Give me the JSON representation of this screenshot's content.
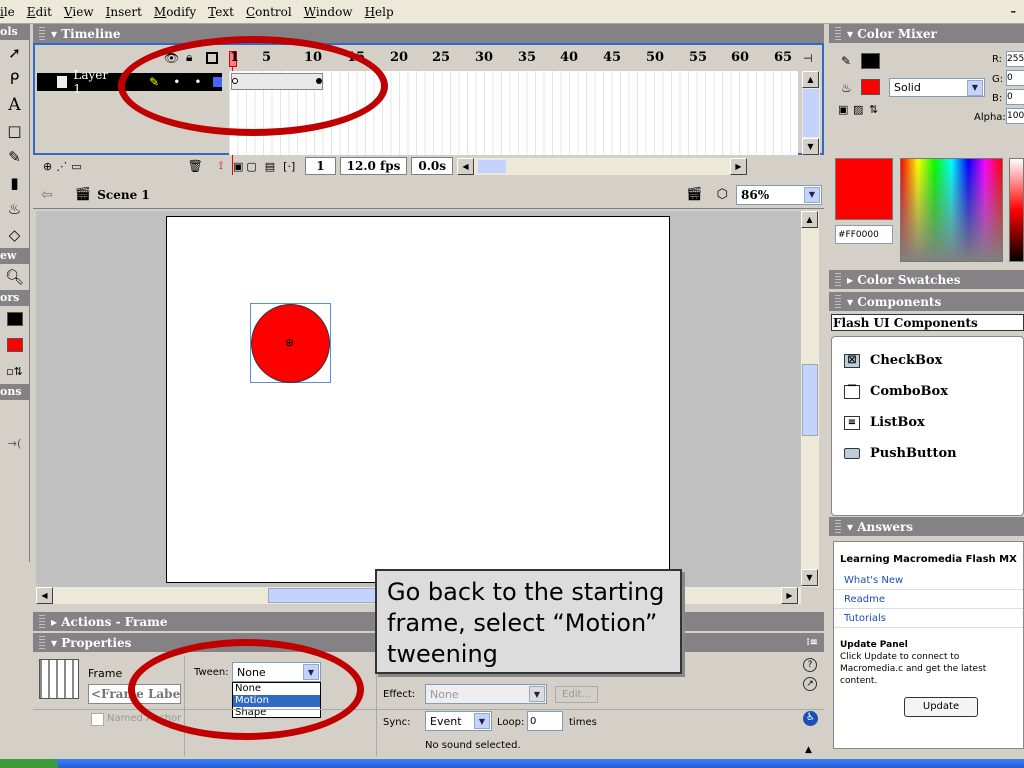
{
  "menu": {
    "items": [
      "ile",
      "Edit",
      "View",
      "Insert",
      "Modify",
      "Text",
      "Control",
      "Window",
      "Help"
    ]
  },
  "tools": {
    "sections": [
      "ols",
      "ew",
      "ors",
      "ons"
    ]
  },
  "timeline": {
    "title": "Timeline",
    "frame_numbers": [
      "1",
      "5",
      "10",
      "15",
      "20",
      "25",
      "30",
      "35",
      "40",
      "45",
      "50",
      "55",
      "60",
      "65"
    ],
    "layer_name": "Layer 1",
    "current_frame": "1",
    "fps": "12.0 fps",
    "elapsed": "0.0s"
  },
  "scene": {
    "name": "Scene 1",
    "zoom": "86%"
  },
  "stage": {
    "shape_color": "#ff0000"
  },
  "actions": {
    "title": "Actions - Frame"
  },
  "properties": {
    "title": "Properties",
    "frame_label": "Frame",
    "frame_input_placeholder": "<Frame Label>",
    "tween_label": "Tween:",
    "tween_value": "None",
    "tween_options": [
      "None",
      "Motion",
      "Shape"
    ],
    "named_anchor": "Named Anchor",
    "effect_label": "Effect:",
    "effect_value": "None",
    "edit_button": "Edit...",
    "sync_label": "Sync:",
    "sync_value": "Event",
    "loop_label": "Loop:",
    "loop_value": "0",
    "times_label": "times",
    "sound_status": "No sound selected."
  },
  "color_mixer": {
    "title": "Color Mixer",
    "fill_type": "Solid",
    "r_label": "R:",
    "r_value": "255",
    "g_label": "G:",
    "g_value": "0",
    "b_label": "B:",
    "b_value": "0",
    "alpha_label": "Alpha:",
    "alpha_value": "100",
    "hex": "#FF0000",
    "fill_color": "#ff0000"
  },
  "color_swatches": {
    "title": "Color Swatches"
  },
  "components": {
    "title": "Components",
    "category": "Flash UI Components",
    "items": [
      "CheckBox",
      "ComboBox",
      "ListBox",
      "PushButton"
    ]
  },
  "answers": {
    "title": "Answers",
    "heading": "Learning Macromedia Flash MX",
    "links": [
      "What's New",
      "Readme",
      "Tutorials"
    ],
    "update_title": "Update Panel",
    "update_text": "Click Update to connect to Macromedia.c and get the latest content.",
    "update_button": "Update"
  },
  "callout": {
    "text": "Go back to the starting frame, select “Motion” tweening"
  },
  "colors": {
    "highlight": "#c00000",
    "selection": "#316ac5"
  }
}
